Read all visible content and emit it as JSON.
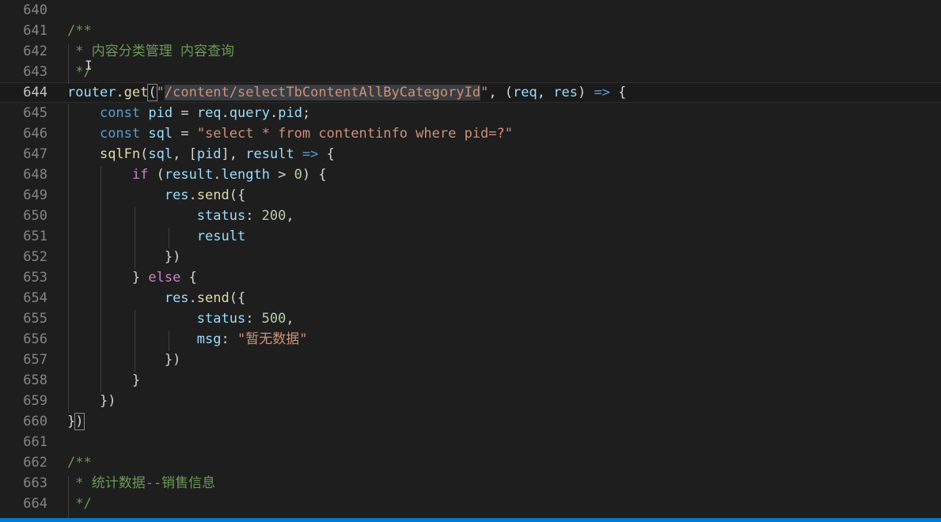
{
  "colors": {
    "background": "#1e1e1e",
    "status_bar": "#007acc",
    "keyword": "#569cd6",
    "string": "#ce9178",
    "comment": "#6a9955",
    "variable": "#9cdcfe",
    "function": "#dcdcaa",
    "number": "#b5cea8"
  },
  "current_line": 644,
  "lines": [
    {
      "num": "640",
      "tokens": []
    },
    {
      "num": "641",
      "tokens": [
        {
          "t": "/**",
          "c": "cmt"
        }
      ]
    },
    {
      "num": "642",
      "tokens": [
        {
          "t": " * 内容分类管理 内容查询",
          "c": "cmt"
        }
      ]
    },
    {
      "num": "643",
      "tokens": [
        {
          "t": " */",
          "c": "cmt"
        }
      ]
    },
    {
      "num": "644",
      "tokens": [
        {
          "t": "router",
          "c": "var"
        },
        {
          "t": ".",
          "c": ""
        },
        {
          "t": "get",
          "c": "fn"
        },
        {
          "t": "(",
          "c": "bracket-match"
        },
        {
          "t": "\"",
          "c": "str"
        },
        {
          "t": "/content/selectTbContentAllByCategoryId",
          "c": "str str-hl"
        },
        {
          "t": "\"",
          "c": "str"
        },
        {
          "t": ", (",
          "c": ""
        },
        {
          "t": "req",
          "c": "var"
        },
        {
          "t": ", ",
          "c": ""
        },
        {
          "t": "res",
          "c": "var"
        },
        {
          "t": ") ",
          "c": ""
        },
        {
          "t": "=>",
          "c": "kw"
        },
        {
          "t": " {",
          "c": ""
        }
      ]
    },
    {
      "num": "645",
      "tokens": [
        {
          "t": "    ",
          "c": ""
        },
        {
          "t": "const",
          "c": "kw"
        },
        {
          "t": " ",
          "c": ""
        },
        {
          "t": "pid",
          "c": "var"
        },
        {
          "t": " = ",
          "c": ""
        },
        {
          "t": "req",
          "c": "var"
        },
        {
          "t": ".",
          "c": ""
        },
        {
          "t": "query",
          "c": "var"
        },
        {
          "t": ".",
          "c": ""
        },
        {
          "t": "pid",
          "c": "var"
        },
        {
          "t": ";",
          "c": ""
        }
      ]
    },
    {
      "num": "646",
      "tokens": [
        {
          "t": "    ",
          "c": ""
        },
        {
          "t": "const",
          "c": "kw"
        },
        {
          "t": " ",
          "c": ""
        },
        {
          "t": "sql",
          "c": "var"
        },
        {
          "t": " = ",
          "c": ""
        },
        {
          "t": "\"select * from contentinfo where pid=?\"",
          "c": "str"
        }
      ]
    },
    {
      "num": "647",
      "tokens": [
        {
          "t": "    ",
          "c": ""
        },
        {
          "t": "sqlFn",
          "c": "fn"
        },
        {
          "t": "(",
          "c": ""
        },
        {
          "t": "sql",
          "c": "var"
        },
        {
          "t": ", [",
          "c": ""
        },
        {
          "t": "pid",
          "c": "var"
        },
        {
          "t": "], ",
          "c": ""
        },
        {
          "t": "result",
          "c": "var"
        },
        {
          "t": " ",
          "c": ""
        },
        {
          "t": "=>",
          "c": "kw"
        },
        {
          "t": " {",
          "c": ""
        }
      ]
    },
    {
      "num": "648",
      "tokens": [
        {
          "t": "        ",
          "c": ""
        },
        {
          "t": "if",
          "c": "ctrl"
        },
        {
          "t": " (",
          "c": ""
        },
        {
          "t": "result",
          "c": "var"
        },
        {
          "t": ".",
          "c": ""
        },
        {
          "t": "length",
          "c": "var"
        },
        {
          "t": " > ",
          "c": ""
        },
        {
          "t": "0",
          "c": "num"
        },
        {
          "t": ") {",
          "c": ""
        }
      ]
    },
    {
      "num": "649",
      "tokens": [
        {
          "t": "            ",
          "c": ""
        },
        {
          "t": "res",
          "c": "var"
        },
        {
          "t": ".",
          "c": ""
        },
        {
          "t": "send",
          "c": "fn"
        },
        {
          "t": "({",
          "c": ""
        }
      ]
    },
    {
      "num": "650",
      "tokens": [
        {
          "t": "                ",
          "c": ""
        },
        {
          "t": "status",
          "c": "var"
        },
        {
          "t": ": ",
          "c": ""
        },
        {
          "t": "200",
          "c": "num"
        },
        {
          "t": ",",
          "c": ""
        }
      ]
    },
    {
      "num": "651",
      "tokens": [
        {
          "t": "                ",
          "c": ""
        },
        {
          "t": "result",
          "c": "var"
        }
      ]
    },
    {
      "num": "652",
      "tokens": [
        {
          "t": "            ",
          "c": ""
        },
        {
          "t": "})",
          "c": ""
        }
      ]
    },
    {
      "num": "653",
      "tokens": [
        {
          "t": "        ",
          "c": ""
        },
        {
          "t": "} ",
          "c": ""
        },
        {
          "t": "else",
          "c": "ctrl"
        },
        {
          "t": " {",
          "c": ""
        }
      ]
    },
    {
      "num": "654",
      "tokens": [
        {
          "t": "            ",
          "c": ""
        },
        {
          "t": "res",
          "c": "var"
        },
        {
          "t": ".",
          "c": ""
        },
        {
          "t": "send",
          "c": "fn"
        },
        {
          "t": "({",
          "c": ""
        }
      ]
    },
    {
      "num": "655",
      "tokens": [
        {
          "t": "                ",
          "c": ""
        },
        {
          "t": "status",
          "c": "var"
        },
        {
          "t": ": ",
          "c": ""
        },
        {
          "t": "500",
          "c": "num"
        },
        {
          "t": ",",
          "c": ""
        }
      ]
    },
    {
      "num": "656",
      "tokens": [
        {
          "t": "                ",
          "c": ""
        },
        {
          "t": "msg",
          "c": "var"
        },
        {
          "t": ": ",
          "c": ""
        },
        {
          "t": "\"暂无数据\"",
          "c": "str"
        }
      ]
    },
    {
      "num": "657",
      "tokens": [
        {
          "t": "            ",
          "c": ""
        },
        {
          "t": "})",
          "c": ""
        }
      ]
    },
    {
      "num": "658",
      "tokens": [
        {
          "t": "        ",
          "c": ""
        },
        {
          "t": "}",
          "c": ""
        }
      ]
    },
    {
      "num": "659",
      "tokens": [
        {
          "t": "    ",
          "c": ""
        },
        {
          "t": "})",
          "c": ""
        }
      ]
    },
    {
      "num": "660",
      "tokens": [
        {
          "t": "}",
          "c": ""
        },
        {
          "t": ")",
          "c": "bracket-match"
        }
      ]
    },
    {
      "num": "661",
      "tokens": []
    },
    {
      "num": "662",
      "tokens": [
        {
          "t": "/**",
          "c": "cmt"
        }
      ]
    },
    {
      "num": "663",
      "tokens": [
        {
          "t": " * 统计数据--销售信息",
          "c": "cmt"
        }
      ]
    },
    {
      "num": "664",
      "tokens": [
        {
          "t": " */",
          "c": "cmt"
        }
      ]
    }
  ]
}
